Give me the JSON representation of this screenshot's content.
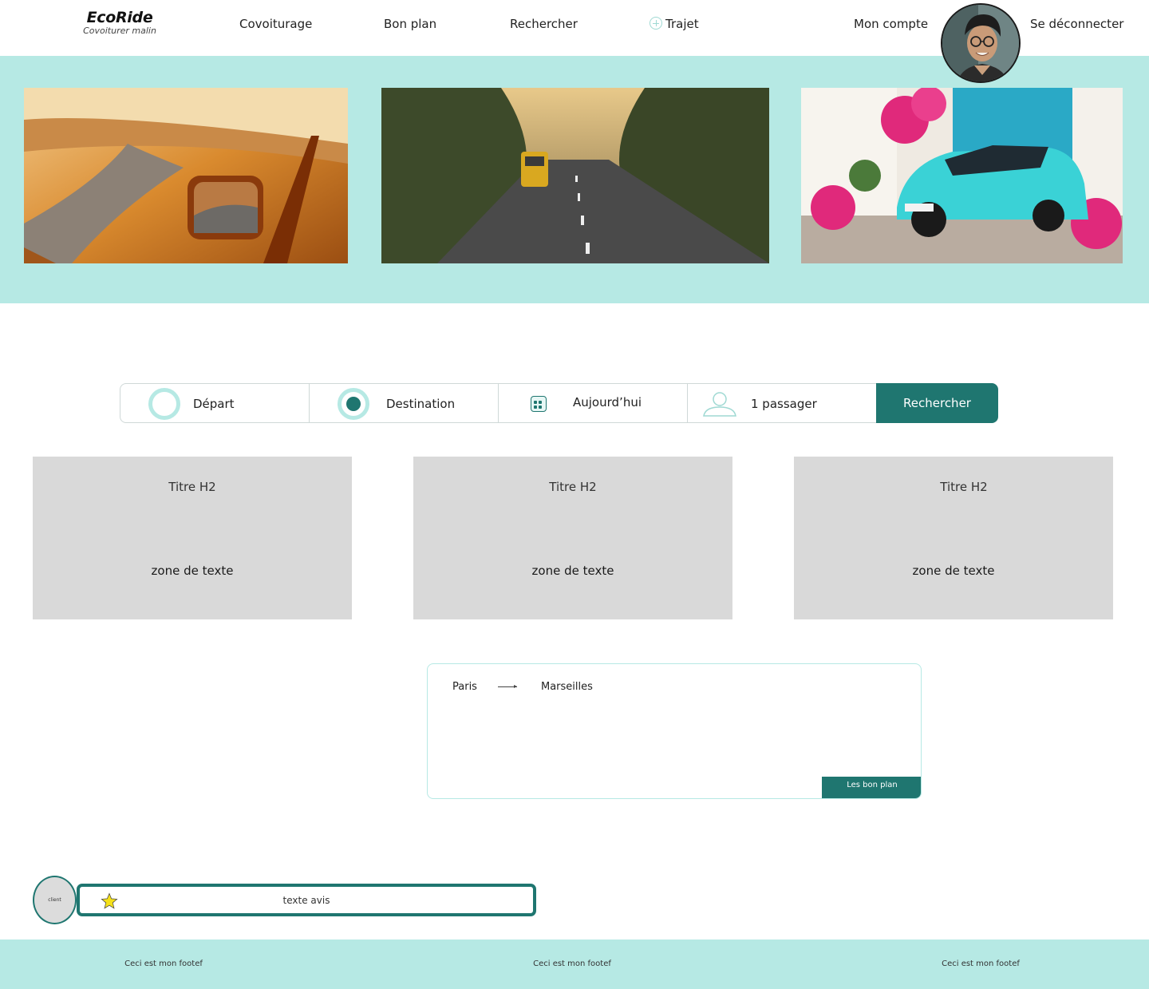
{
  "header": {
    "logo_title": "EcoRide",
    "logo_subtitle": "Covoiturer malin",
    "nav": {
      "covoiturage": "Covoiturage",
      "bon_plan": "Bon plan",
      "rechercher": "Rechercher",
      "trajet": "Trajet",
      "mon_compte": "Mon compte",
      "deconnecter": "Se déconnecter"
    },
    "plus_icon": "plus-circle-icon",
    "avatar_icon": "user-avatar"
  },
  "hero": {
    "background": "#b6e9e4",
    "images": [
      "sunset-road-car-mirror",
      "forest-road-yellow-van",
      "turquoise-electric-car-flowers"
    ]
  },
  "search": {
    "depart": "Départ",
    "destination": "Destination",
    "date": "Aujourd’hui",
    "passengers": "1 passager",
    "button": "Rechercher",
    "icons": [
      "ring-icon",
      "ring-filled-icon",
      "calendar-icon",
      "person-icon"
    ]
  },
  "cards": [
    {
      "title": "Titre H2",
      "text": "zone de texte"
    },
    {
      "title": "Titre H2",
      "text": "zone de texte"
    },
    {
      "title": "Titre H2",
      "text": "zone de texte"
    }
  ],
  "trip": {
    "from": "Paris",
    "to": "Marseilles",
    "button": "Les bon plan"
  },
  "review": {
    "client": "client",
    "text": "texte avis",
    "star_icon": "star-icon"
  },
  "footer": {
    "items": [
      "Ceci est mon footef",
      "Ceci est mon footef",
      "Ceci est mon footef"
    ]
  },
  "colors": {
    "accent": "#1f7670",
    "mint": "#b6e9e4",
    "card_gray": "#d9d9d9",
    "star": "#f5e11a"
  }
}
